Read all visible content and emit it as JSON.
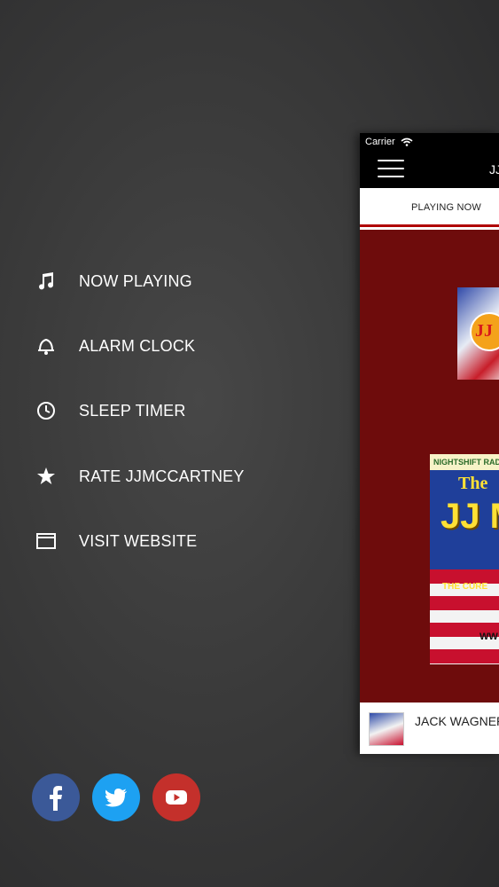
{
  "menu": {
    "items": [
      {
        "label": "NOW PLAYING",
        "icon": "music-note-icon"
      },
      {
        "label": "ALARM CLOCK",
        "icon": "bell-icon"
      },
      {
        "label": "SLEEP TIMER",
        "icon": "clock-icon"
      },
      {
        "label": "RATE JJMCCARTNEY",
        "icon": "star-icon"
      },
      {
        "label": "VISIT WEBSITE",
        "icon": "browser-window-icon"
      }
    ]
  },
  "social": [
    {
      "name": "facebook",
      "color": "#3b5998"
    },
    {
      "name": "twitter",
      "color": "#1da1f2"
    },
    {
      "name": "youtube",
      "color": "#c4302b"
    }
  ],
  "preview": {
    "carrier": "Carrier",
    "title": "JJ",
    "tab": "PLAYING NOW",
    "now_playing": "JACK WAGNER",
    "logo_text": "JJ",
    "cover": {
      "band": "NIGHTSHIFT RADIO",
      "the": "The",
      "name": "JJ M",
      "tagline": "THE CURE",
      "url": "WW"
    },
    "accent": "#6e0c0c"
  }
}
